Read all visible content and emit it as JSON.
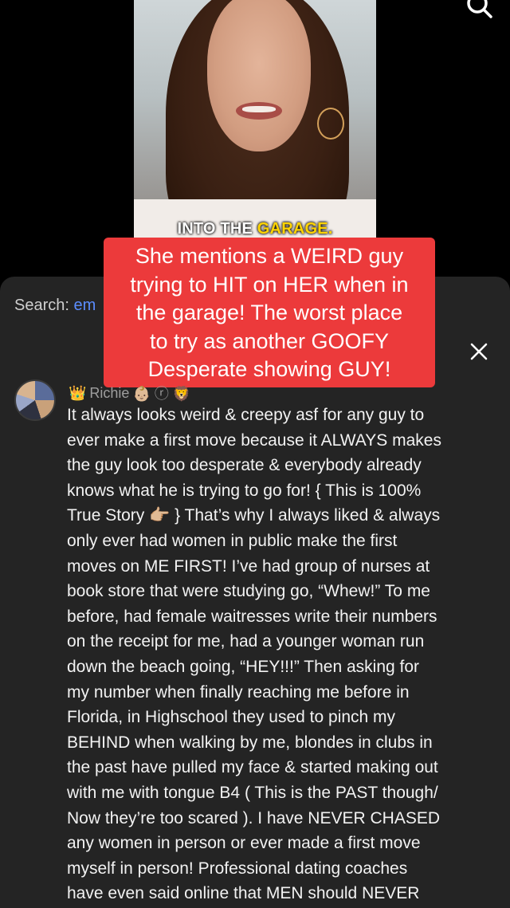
{
  "video": {
    "caption_prefix": "INTO THE",
    "caption_highlight": "GARAGE."
  },
  "overlay": {
    "lines": [
      "She mentions a WEIRD guy",
      "trying to HIT on HER when in",
      "the garage! The worst place",
      "to try as another GOOFY",
      "Desperate showing GUY!"
    ]
  },
  "search": {
    "label": "Search:",
    "query": "em"
  },
  "comment": {
    "username_prefix": "👑",
    "username": "Richie",
    "username_emojis": "👶🏼 ⓡ 🦁",
    "pointing_emoji": "👉🏼",
    "lines": [
      "It always looks weird & creepy asf for any guy to",
      "ever make a first move because it ALWAYS makes",
      "the guy look too desperate & everybody already",
      "knows what he is trying to go for! { This is 100%",
      "True Story",
      " } That’s why I always liked & always",
      "only ever had women in public make the first",
      "moves on ME FIRST! I’ve had group of nurses at",
      "book store that were studying go, “Whew!” To me",
      "before, had female waitresses write their numbers",
      "on the receipt for me, had a younger woman run",
      "down the beach going, “HEY!!!” Then asking for",
      "my number when finally reaching me before in",
      "Florida, in Highschool they used to pinch my",
      "BEHIND when walking by me, blondes in clubs in",
      "the past have pulled my face & started making out",
      "with me with tongue B4 ( This is the PAST though/",
      "Now they’re too scared ). I have NEVER CHASED",
      "any women in person or ever made a first move",
      "myself in person! Professional dating coaches",
      "have even said online that MEN should NEVER"
    ]
  },
  "colors": {
    "overlay_bg": "#ec3a3b",
    "sheet_bg": "#242424",
    "search_query": "#5b8dff",
    "caption_highlight": "#ffd400"
  }
}
